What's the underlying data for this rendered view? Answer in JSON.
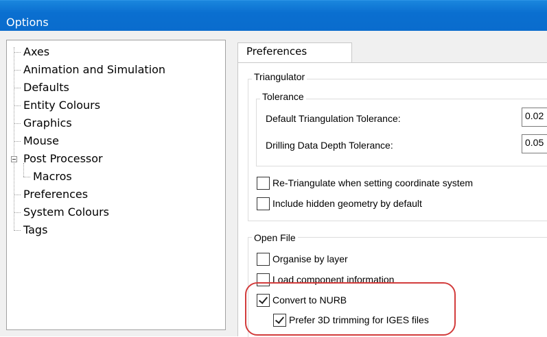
{
  "window": {
    "title": "Options"
  },
  "tree": {
    "items": [
      {
        "label": "Axes"
      },
      {
        "label": "Animation and Simulation"
      },
      {
        "label": "Defaults"
      },
      {
        "label": "Entity Colours"
      },
      {
        "label": "Graphics"
      },
      {
        "label": "Mouse"
      },
      {
        "label": "Post Processor",
        "expanded": true
      },
      {
        "label": "Macros",
        "child": true
      },
      {
        "label": "Preferences",
        "selected": true
      },
      {
        "label": "System Colours"
      },
      {
        "label": "Tags"
      }
    ]
  },
  "tab": {
    "label": "Preferences"
  },
  "triangulator": {
    "title": "Triangulator",
    "tolerance": {
      "title": "Tolerance",
      "default_label": "Default Triangulation Tolerance:",
      "default_value": "0.02",
      "drilling_label": "Drilling Data Depth Tolerance:",
      "drilling_value": "0.05"
    },
    "retriangulate": {
      "label": "Re-Triangulate when setting coordinate system",
      "checked": false
    },
    "hidden_geometry": {
      "label": "Include hidden geometry by default",
      "checked": false
    }
  },
  "open_file": {
    "title": "Open File",
    "organise": {
      "label": "Organise by layer",
      "checked": false
    },
    "load_component": {
      "label": "Load component information",
      "checked": false
    },
    "convert_nurb": {
      "label": "Convert to NURB",
      "checked": true
    },
    "prefer_3d": {
      "label": "Prefer 3D trimming for IGES files",
      "checked": true
    }
  },
  "colors": {
    "titlebar": "#0a6fd0",
    "highlight_ring": "#d23b3b"
  }
}
